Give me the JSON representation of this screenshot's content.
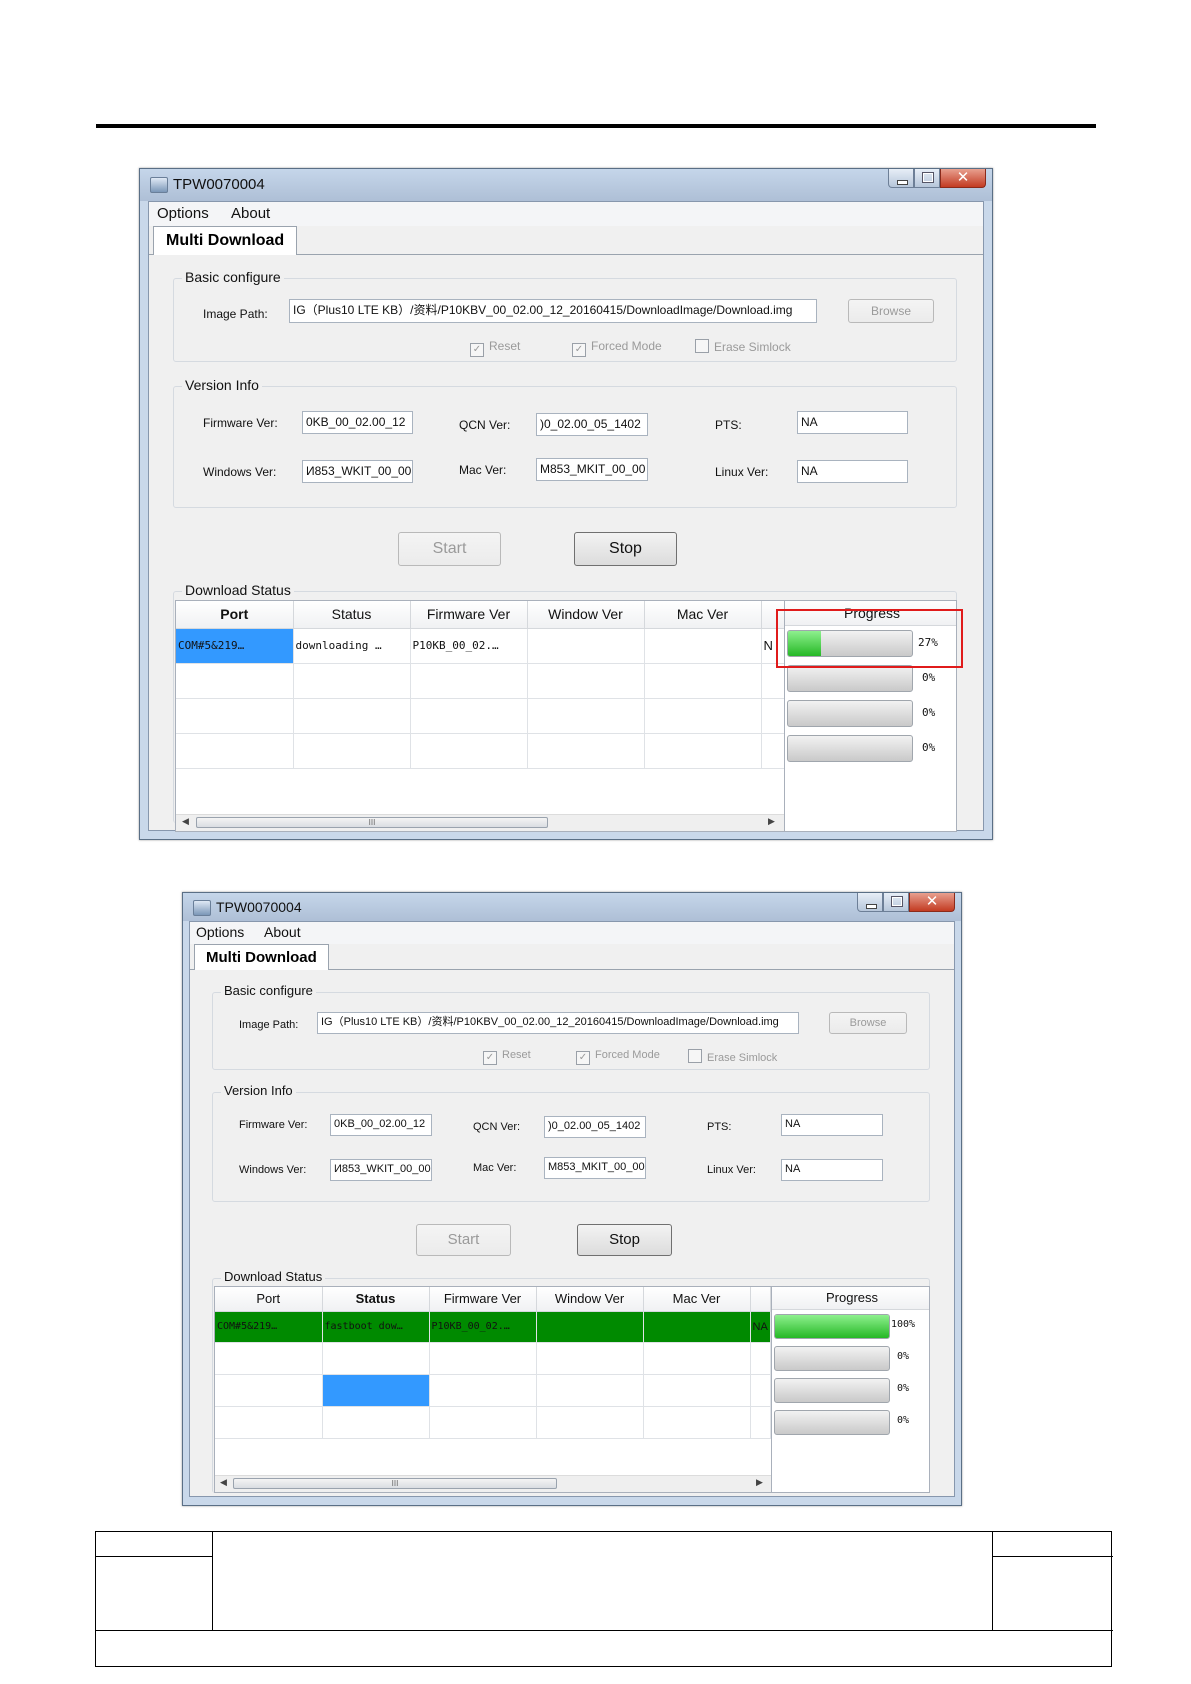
{
  "windows": [
    {
      "title": "TPW0070004",
      "menu": [
        "Options",
        "About"
      ],
      "tab": "Multi Download",
      "basic_group": "Basic configure",
      "image_path_label": "Image Path:",
      "image_path_value": "ІG（Plus10 LTE KB）/资料/P10KBV_00_02.00_12_20160415/DownloadImage/Download.img",
      "browse_label": "Browse",
      "reset_label": "Reset",
      "forced_mode_label": "Forced Mode",
      "erase_simlock_label": "Erase Simlock",
      "version_group": "Version Info",
      "firmware_label": "Firmware Ver:",
      "firmware_value": "0KB_00_02.00_12",
      "qcn_label": "QCN Ver:",
      "qcn_value": ")0_02.00_05_1402",
      "pts_label": "PTS:",
      "pts_value": "NA",
      "windows_label": "Windows Ver:",
      "windows_value": "И853_WKIT_00_00",
      "mac_label": "Mac Ver:",
      "mac_value": "M853_MKIT_00_00",
      "linux_label": "Linux Ver:",
      "linux_value": "NA",
      "start_label": "Start",
      "stop_label": "Stop",
      "download_group": "Download Status",
      "columns": [
        "Port",
        "Status",
        "Firmware Ver",
        "Window Ver",
        "Mac Ver"
      ],
      "progress_header": "Progress",
      "rows": [
        {
          "port": "COM#5&219…",
          "status": "downloading …",
          "firmware": "P10KB_00_02.…",
          "window": "",
          "mac": "",
          "clip": "N"
        },
        {
          "port": "",
          "status": "",
          "firmware": "",
          "window": "",
          "mac": "",
          "clip": ""
        },
        {
          "port": "",
          "status": "",
          "firmware": "",
          "window": "",
          "mac": "",
          "clip": ""
        },
        {
          "port": "",
          "status": "",
          "firmware": "",
          "window": "",
          "mac": "",
          "clip": ""
        }
      ],
      "progress": [
        {
          "value": 27,
          "label": "27%"
        },
        {
          "value": 0,
          "label": "0%"
        },
        {
          "value": 0,
          "label": "0%"
        },
        {
          "value": 0,
          "label": "0%"
        }
      ],
      "scroll_grip": "III"
    },
    {
      "title": "TPW0070004",
      "menu": [
        "Options",
        "About"
      ],
      "tab": "Multi Download",
      "basic_group": "Basic configure",
      "image_path_label": "Image Path:",
      "image_path_value": "ІG（Plus10 LTE KB）/资料/P10KBV_00_02.00_12_20160415/DownloadImage/Download.img",
      "browse_label": "Browse",
      "reset_label": "Reset",
      "forced_mode_label": "Forced Mode",
      "erase_simlock_label": "Erase Simlock",
      "version_group": "Version Info",
      "firmware_label": "Firmware Ver:",
      "firmware_value": "0KB_00_02.00_12",
      "qcn_label": "QCN Ver:",
      "qcn_value": ")0_02.00_05_1402",
      "pts_label": "PTS:",
      "pts_value": "NA",
      "windows_label": "Windows Ver:",
      "windows_value": "И853_WKIT_00_00",
      "mac_label": "Mac Ver:",
      "mac_value": "M853_MKIT_00_00",
      "linux_label": "Linux Ver:",
      "linux_value": "NA",
      "start_label": "Start",
      "stop_label": "Stop",
      "download_group": "Download Status",
      "columns": [
        "Port",
        "Status",
        "Firmware Ver",
        "Window Ver",
        "Mac Ver"
      ],
      "progress_header": "Progress",
      "rows": [
        {
          "port": "COM#5&219…",
          "status": "fastboot dow…",
          "firmware": "P10KB_00_02.…",
          "window": "",
          "mac": "",
          "clip": "NA"
        },
        {
          "port": "",
          "status": "",
          "firmware": "",
          "window": "",
          "mac": "",
          "clip": ""
        },
        {
          "port": "",
          "status": "",
          "firmware": "",
          "window": "",
          "mac": "",
          "clip": ""
        },
        {
          "port": "",
          "status": "",
          "firmware": "",
          "window": "",
          "mac": "",
          "clip": ""
        }
      ],
      "progress": [
        {
          "value": 100,
          "label": "100%"
        },
        {
          "value": 0,
          "label": "0%"
        },
        {
          "value": 0,
          "label": "0%"
        },
        {
          "value": 0,
          "label": "0%"
        }
      ],
      "scroll_grip": "III"
    }
  ],
  "colors": {
    "highlight": "#e01b1b",
    "selection": "#3399ff",
    "complete_row": "#008a00",
    "progress_fill": "#26b826"
  }
}
